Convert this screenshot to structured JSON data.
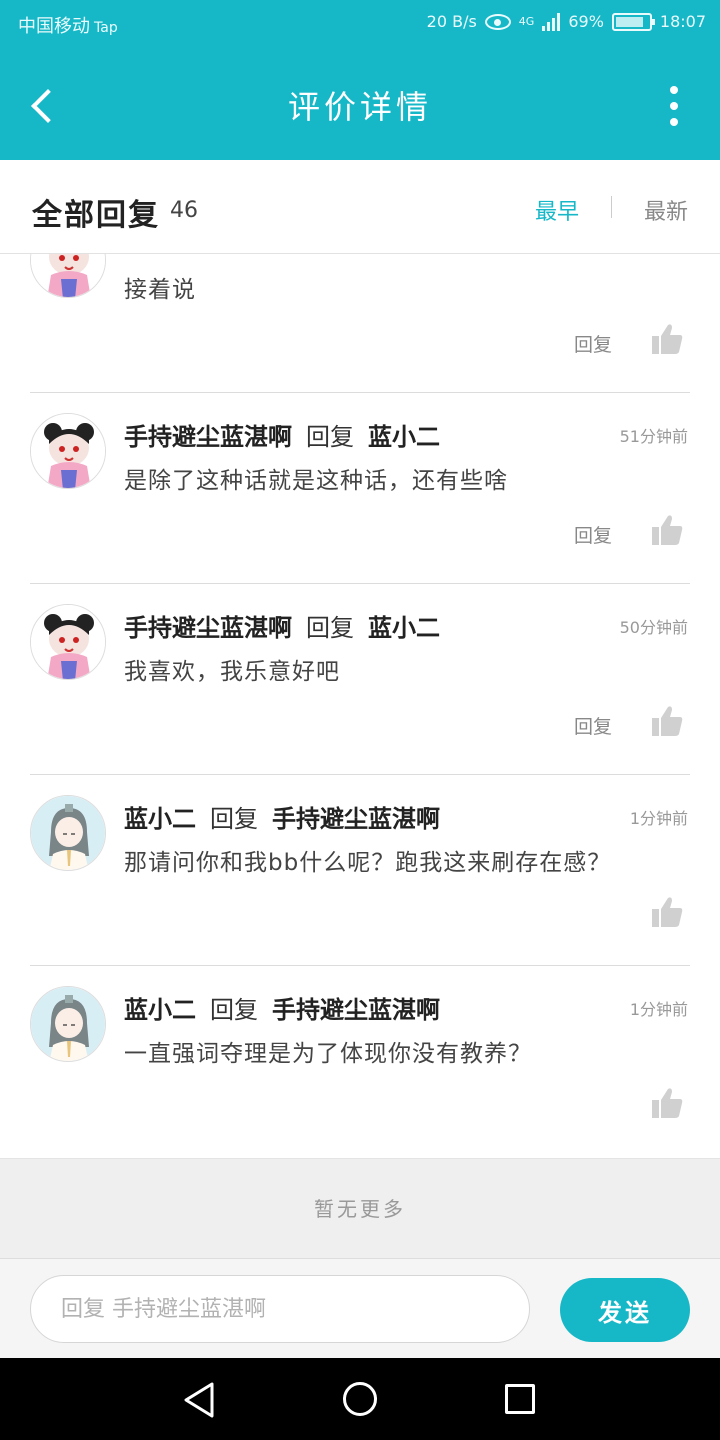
{
  "status_bar": {
    "carrier": "中国移动",
    "carrier_app": "Tap",
    "net_speed": "20 B/s",
    "network": "4G",
    "battery": "69%",
    "time": "18:07"
  },
  "app_bar": {
    "title": "评价详情",
    "back_icon": "back-arrow-icon",
    "more_icon": "more-vertical-icon"
  },
  "reply_header": {
    "title": "全部回复",
    "count": "46",
    "sort_early": "最早",
    "sort_new": "最新",
    "active_sort": "最早"
  },
  "comments": [
    {
      "avatar": "panda-girl-avatar",
      "author": "",
      "verb": "",
      "target": "",
      "time": "",
      "content": "接着说",
      "reply_label": "回复"
    },
    {
      "avatar": "panda-girl-avatar",
      "author": "手持避尘蓝湛啊",
      "verb": "回复",
      "target": "蓝小二",
      "time": "51分钟前",
      "content": "是除了这种话就是这种话，还有些啥",
      "reply_label": "回复"
    },
    {
      "avatar": "panda-girl-avatar",
      "author": "手持避尘蓝湛啊",
      "verb": "回复",
      "target": "蓝小二",
      "time": "50分钟前",
      "content": "我喜欢，我乐意好吧",
      "reply_label": "回复"
    },
    {
      "avatar": "ancient-boy-avatar",
      "author": "蓝小二",
      "verb": "回复",
      "target": "手持避尘蓝湛啊",
      "time": "1分钟前",
      "content": "那请问你和我bb什么呢？跑我这来刷存在感？",
      "reply_label": ""
    },
    {
      "avatar": "ancient-boy-avatar",
      "author": "蓝小二",
      "verb": "回复",
      "target": "手持避尘蓝湛啊",
      "time": "1分钟前",
      "content": "一直强词夺理是为了体现你没有教养？",
      "reply_label": ""
    }
  ],
  "footer": {
    "no_more": "暂无更多"
  },
  "input_bar": {
    "placeholder": "回复 手持避尘蓝湛啊",
    "send_label": "发送"
  },
  "colors": {
    "accent": "#16b8c8",
    "like_icon": "#d0d0d0"
  }
}
